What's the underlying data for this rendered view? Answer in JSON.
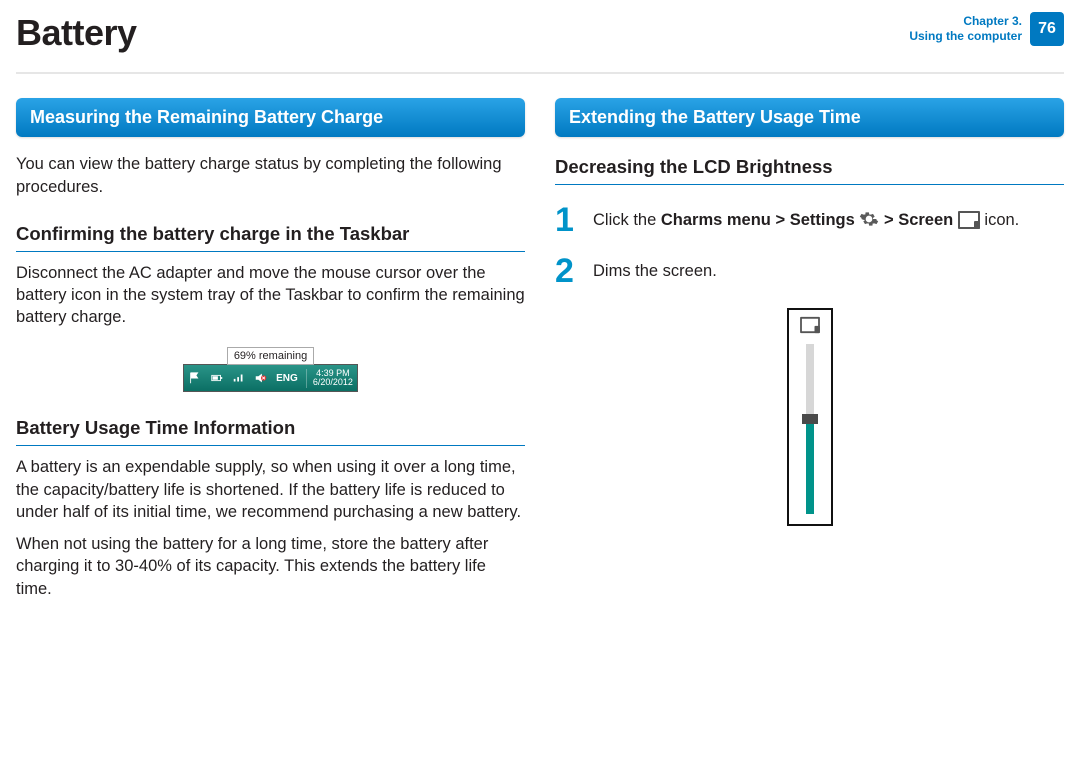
{
  "header": {
    "title": "Battery",
    "chapter_line1": "Chapter 3.",
    "chapter_line2": "Using the computer",
    "page_number": "76"
  },
  "left": {
    "section_title": "Measuring the Remaining Battery Charge",
    "intro": "You can view the battery charge status by completing the following procedures.",
    "sub1_title": "Confirming the battery charge in the Taskbar",
    "sub1_para": "Disconnect the AC adapter and move the mouse cursor over the battery icon in the system tray of the Taskbar to confirm the remaining battery charge.",
    "taskbar": {
      "tooltip": "69% remaining",
      "lang": "ENG",
      "time": "4:39 PM",
      "date": "6/20/2012"
    },
    "sub2_title": "Battery Usage Time Information",
    "sub2_para1": "A battery is an expendable supply, so when using it over a long time, the capacity/battery life is shortened. If the battery life is reduced to under half of its initial time, we recommend purchasing a new battery.",
    "sub2_para2": "When not using the battery for a long time, store the battery after charging it to 30-40% of its capacity. This extends the battery life time."
  },
  "right": {
    "section_title": "Extending the Battery Usage Time",
    "sub1_title": "Decreasing the LCD Brightness",
    "step1_pre": "Click the ",
    "step1_charms": "Charms menu > Settings ",
    "step1_mid": " > ",
    "step1_screen": "Screen ",
    "step1_post": " icon.",
    "step2": "Dims the screen."
  }
}
